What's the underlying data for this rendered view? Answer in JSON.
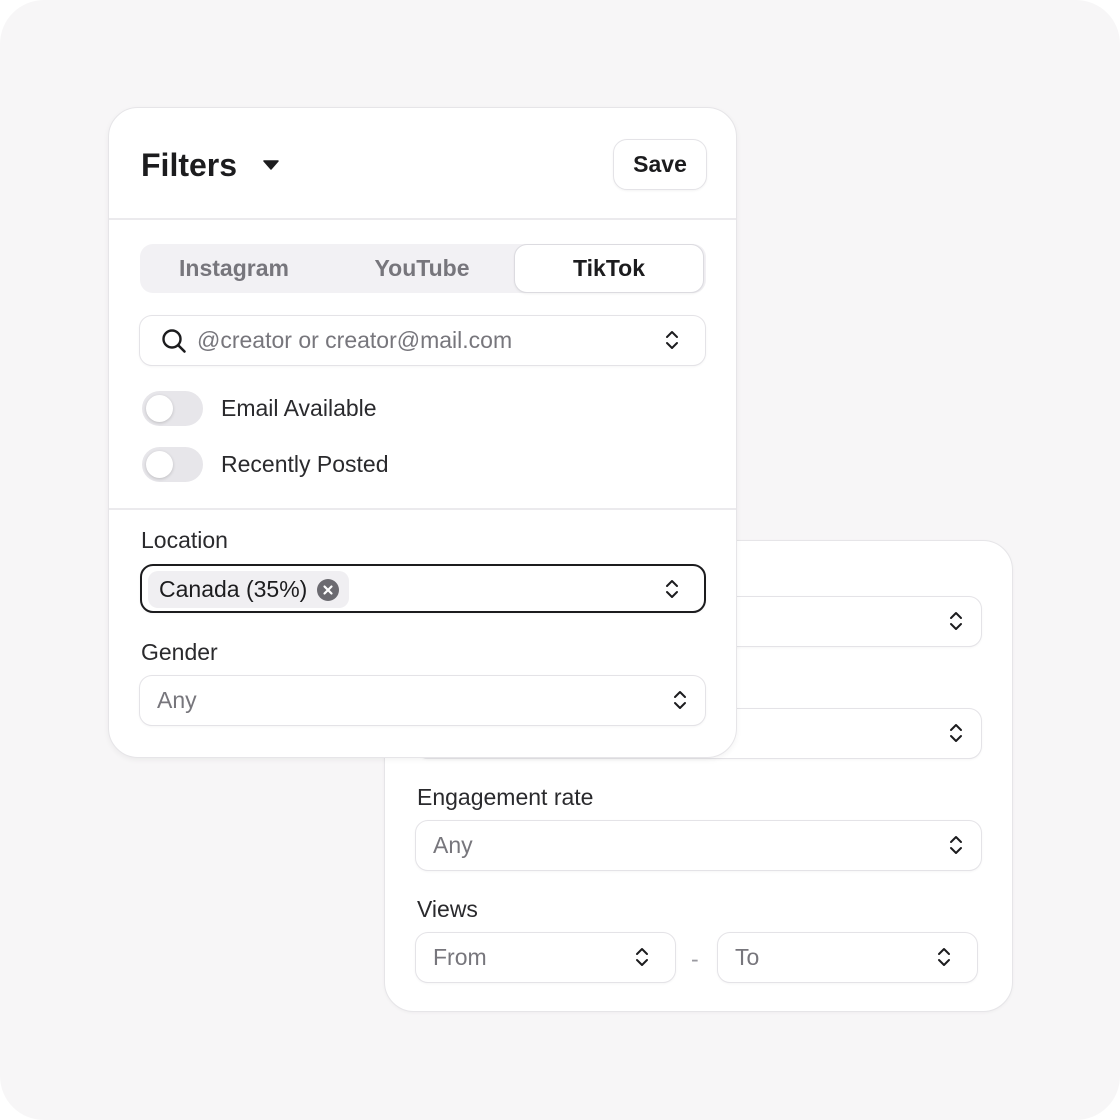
{
  "filters_panel": {
    "title": "Filters",
    "save_label": "Save",
    "platform_tabs": [
      {
        "label": "Instagram",
        "active": false
      },
      {
        "label": "YouTube",
        "active": false
      },
      {
        "label": "TikTok",
        "active": true
      }
    ],
    "search": {
      "placeholder": "@creator or creator@mail.com"
    },
    "toggles": [
      {
        "label": "Email Available",
        "on": false
      },
      {
        "label": "Recently Posted",
        "on": false
      }
    ],
    "location": {
      "label": "Location",
      "chip": "Canada (35%)"
    },
    "gender": {
      "label": "Gender",
      "value": "Any"
    }
  },
  "secondary_panel": {
    "engagement_rate": {
      "label": "Engagement rate",
      "value": "Any"
    },
    "views": {
      "label": "Views",
      "from_placeholder": "From",
      "separator": "-",
      "to_placeholder": "To"
    }
  },
  "colors": {
    "background": "#f7f6f7",
    "card": "#ffffff",
    "border": "#e4e3e7",
    "text_primary": "#1c1c1e",
    "text_muted": "#77767c",
    "toggle_off": "#e7e6ea"
  },
  "icons": [
    "chevron-down-icon",
    "search-icon",
    "chevron-up-down-icon",
    "close-circle-icon"
  ]
}
